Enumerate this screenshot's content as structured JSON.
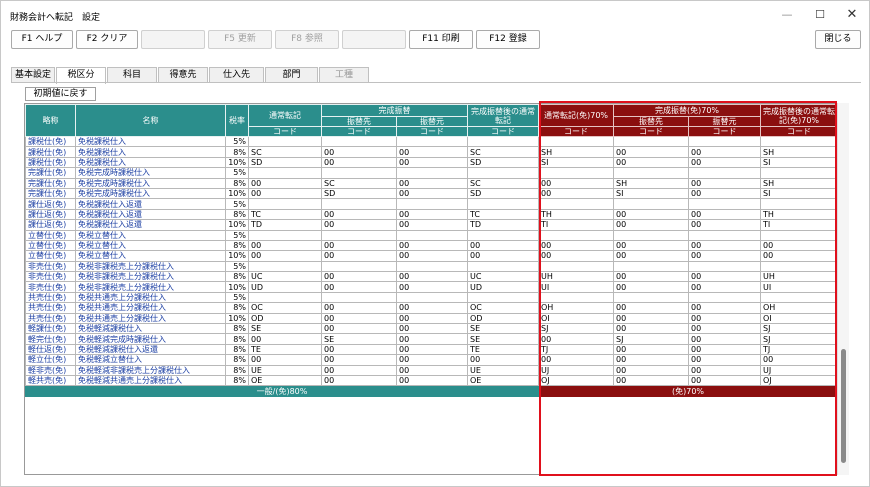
{
  "window": {
    "title": "財務会計へ転記　設定"
  },
  "fkeys": [
    {
      "label": "F1 ヘルプ",
      "enabled": true
    },
    {
      "label": "F2 クリア",
      "enabled": true
    },
    {
      "label": "",
      "enabled": false
    },
    {
      "label": "F5 更新",
      "enabled": false
    },
    {
      "label": "F8 参照",
      "enabled": false
    },
    {
      "label": "",
      "enabled": false
    },
    {
      "label": "F11 印刷",
      "enabled": true
    },
    {
      "label": "F12 登録",
      "enabled": true
    }
  ],
  "close_label": "閉じる",
  "tabs": [
    {
      "label": "基本設定",
      "active": false
    },
    {
      "label": "税区分",
      "active": true
    },
    {
      "label": "科目",
      "active": false
    },
    {
      "label": "得意先",
      "active": false
    },
    {
      "label": "仕入先",
      "active": false
    },
    {
      "label": "部門",
      "active": false
    },
    {
      "label": "工種",
      "active": false
    }
  ],
  "reset_button": "初期値に戻す",
  "headers": {
    "abbr": "略称",
    "name": "名称",
    "rate": "税率",
    "normal": "通常転記",
    "kansei": "完成振替",
    "sakisaki": "振替先",
    "moto": "振替元",
    "kansei_after": "完成振替後の通常転記",
    "normal_free": "通常転記(免)70%",
    "kansei_free": "完成振替(免)70%",
    "kansei_after_free": "完成振替後の通常転記(免)70%",
    "code": "コード"
  },
  "rows": [
    [
      "課税仕(免)",
      "免税課税仕入",
      "5%",
      "",
      "",
      "",
      "",
      "",
      "",
      "",
      ""
    ],
    [
      "課税仕(免)",
      "免税課税仕入",
      "8%",
      "SC",
      "00",
      "00",
      "SC",
      "SH",
      "00",
      "00",
      "SH"
    ],
    [
      "課税仕(免)",
      "免税課税仕入",
      "10%",
      "SD",
      "00",
      "00",
      "SD",
      "SI",
      "00",
      "00",
      "SI"
    ],
    [
      "完課仕(免)",
      "免税完成時課税仕入",
      "5%",
      "",
      "",
      "",
      "",
      "",
      "",
      "",
      ""
    ],
    [
      "完課仕(免)",
      "免税完成時課税仕入",
      "8%",
      "00",
      "SC",
      "00",
      "SC",
      "00",
      "SH",
      "00",
      "SH"
    ],
    [
      "完課仕(免)",
      "免税完成時課税仕入",
      "10%",
      "00",
      "SD",
      "00",
      "SD",
      "00",
      "SI",
      "00",
      "SI"
    ],
    [
      "課仕返(免)",
      "免税課税仕入返還",
      "5%",
      "",
      "",
      "",
      "",
      "",
      "",
      "",
      ""
    ],
    [
      "課仕返(免)",
      "免税課税仕入返還",
      "8%",
      "TC",
      "00",
      "00",
      "TC",
      "TH",
      "00",
      "00",
      "TH"
    ],
    [
      "課仕返(免)",
      "免税課税仕入返還",
      "10%",
      "TD",
      "00",
      "00",
      "TD",
      "TI",
      "00",
      "00",
      "TI"
    ],
    [
      "立替仕(免)",
      "免税立替仕入",
      "5%",
      "",
      "",
      "",
      "",
      "",
      "",
      "",
      ""
    ],
    [
      "立替仕(免)",
      "免税立替仕入",
      "8%",
      "00",
      "00",
      "00",
      "00",
      "00",
      "00",
      "00",
      "00"
    ],
    [
      "立替仕(免)",
      "免税立替仕入",
      "10%",
      "00",
      "00",
      "00",
      "00",
      "00",
      "00",
      "00",
      "00"
    ],
    [
      "非売仕(免)",
      "免税非課税売上分課税仕入",
      "5%",
      "",
      "",
      "",
      "",
      "",
      "",
      "",
      ""
    ],
    [
      "非売仕(免)",
      "免税非課税売上分課税仕入",
      "8%",
      "UC",
      "00",
      "00",
      "UC",
      "UH",
      "00",
      "00",
      "UH"
    ],
    [
      "非売仕(免)",
      "免税非課税売上分課税仕入",
      "10%",
      "UD",
      "00",
      "00",
      "UD",
      "UI",
      "00",
      "00",
      "UI"
    ],
    [
      "共売仕(免)",
      "免税共通売上分課税仕入",
      "5%",
      "",
      "",
      "",
      "",
      "",
      "",
      "",
      ""
    ],
    [
      "共売仕(免)",
      "免税共通売上分課税仕入",
      "8%",
      "OC",
      "00",
      "00",
      "OC",
      "OH",
      "00",
      "00",
      "OH"
    ],
    [
      "共売仕(免)",
      "免税共通売上分課税仕入",
      "10%",
      "OD",
      "00",
      "00",
      "OD",
      "OI",
      "00",
      "00",
      "OI"
    ],
    [
      "軽課仕(免)",
      "免税軽減課税仕入",
      "8%",
      "SE",
      "00",
      "00",
      "SE",
      "SJ",
      "00",
      "00",
      "SJ"
    ],
    [
      "軽完仕(免)",
      "免税軽減完成時課税仕入",
      "8%",
      "00",
      "SE",
      "00",
      "SE",
      "00",
      "SJ",
      "00",
      "SJ"
    ],
    [
      "軽仕返(免)",
      "免税軽減課税仕入返還",
      "8%",
      "TE",
      "00",
      "00",
      "TE",
      "TJ",
      "00",
      "00",
      "TJ"
    ],
    [
      "軽立仕(免)",
      "免税軽減立替仕入",
      "8%",
      "00",
      "00",
      "00",
      "00",
      "00",
      "00",
      "00",
      "00"
    ],
    [
      "軽非売(免)",
      "免税軽減非課税売上分課税仕入",
      "8%",
      "UE",
      "00",
      "00",
      "UE",
      "UJ",
      "00",
      "00",
      "UJ"
    ],
    [
      "軽共売(免)",
      "免税軽減共通売上分課税仕入",
      "8%",
      "OE",
      "00",
      "00",
      "OE",
      "OJ",
      "00",
      "00",
      "OJ"
    ]
  ],
  "footer": {
    "left": "一般/(免)80%",
    "right": "(免)70%"
  }
}
